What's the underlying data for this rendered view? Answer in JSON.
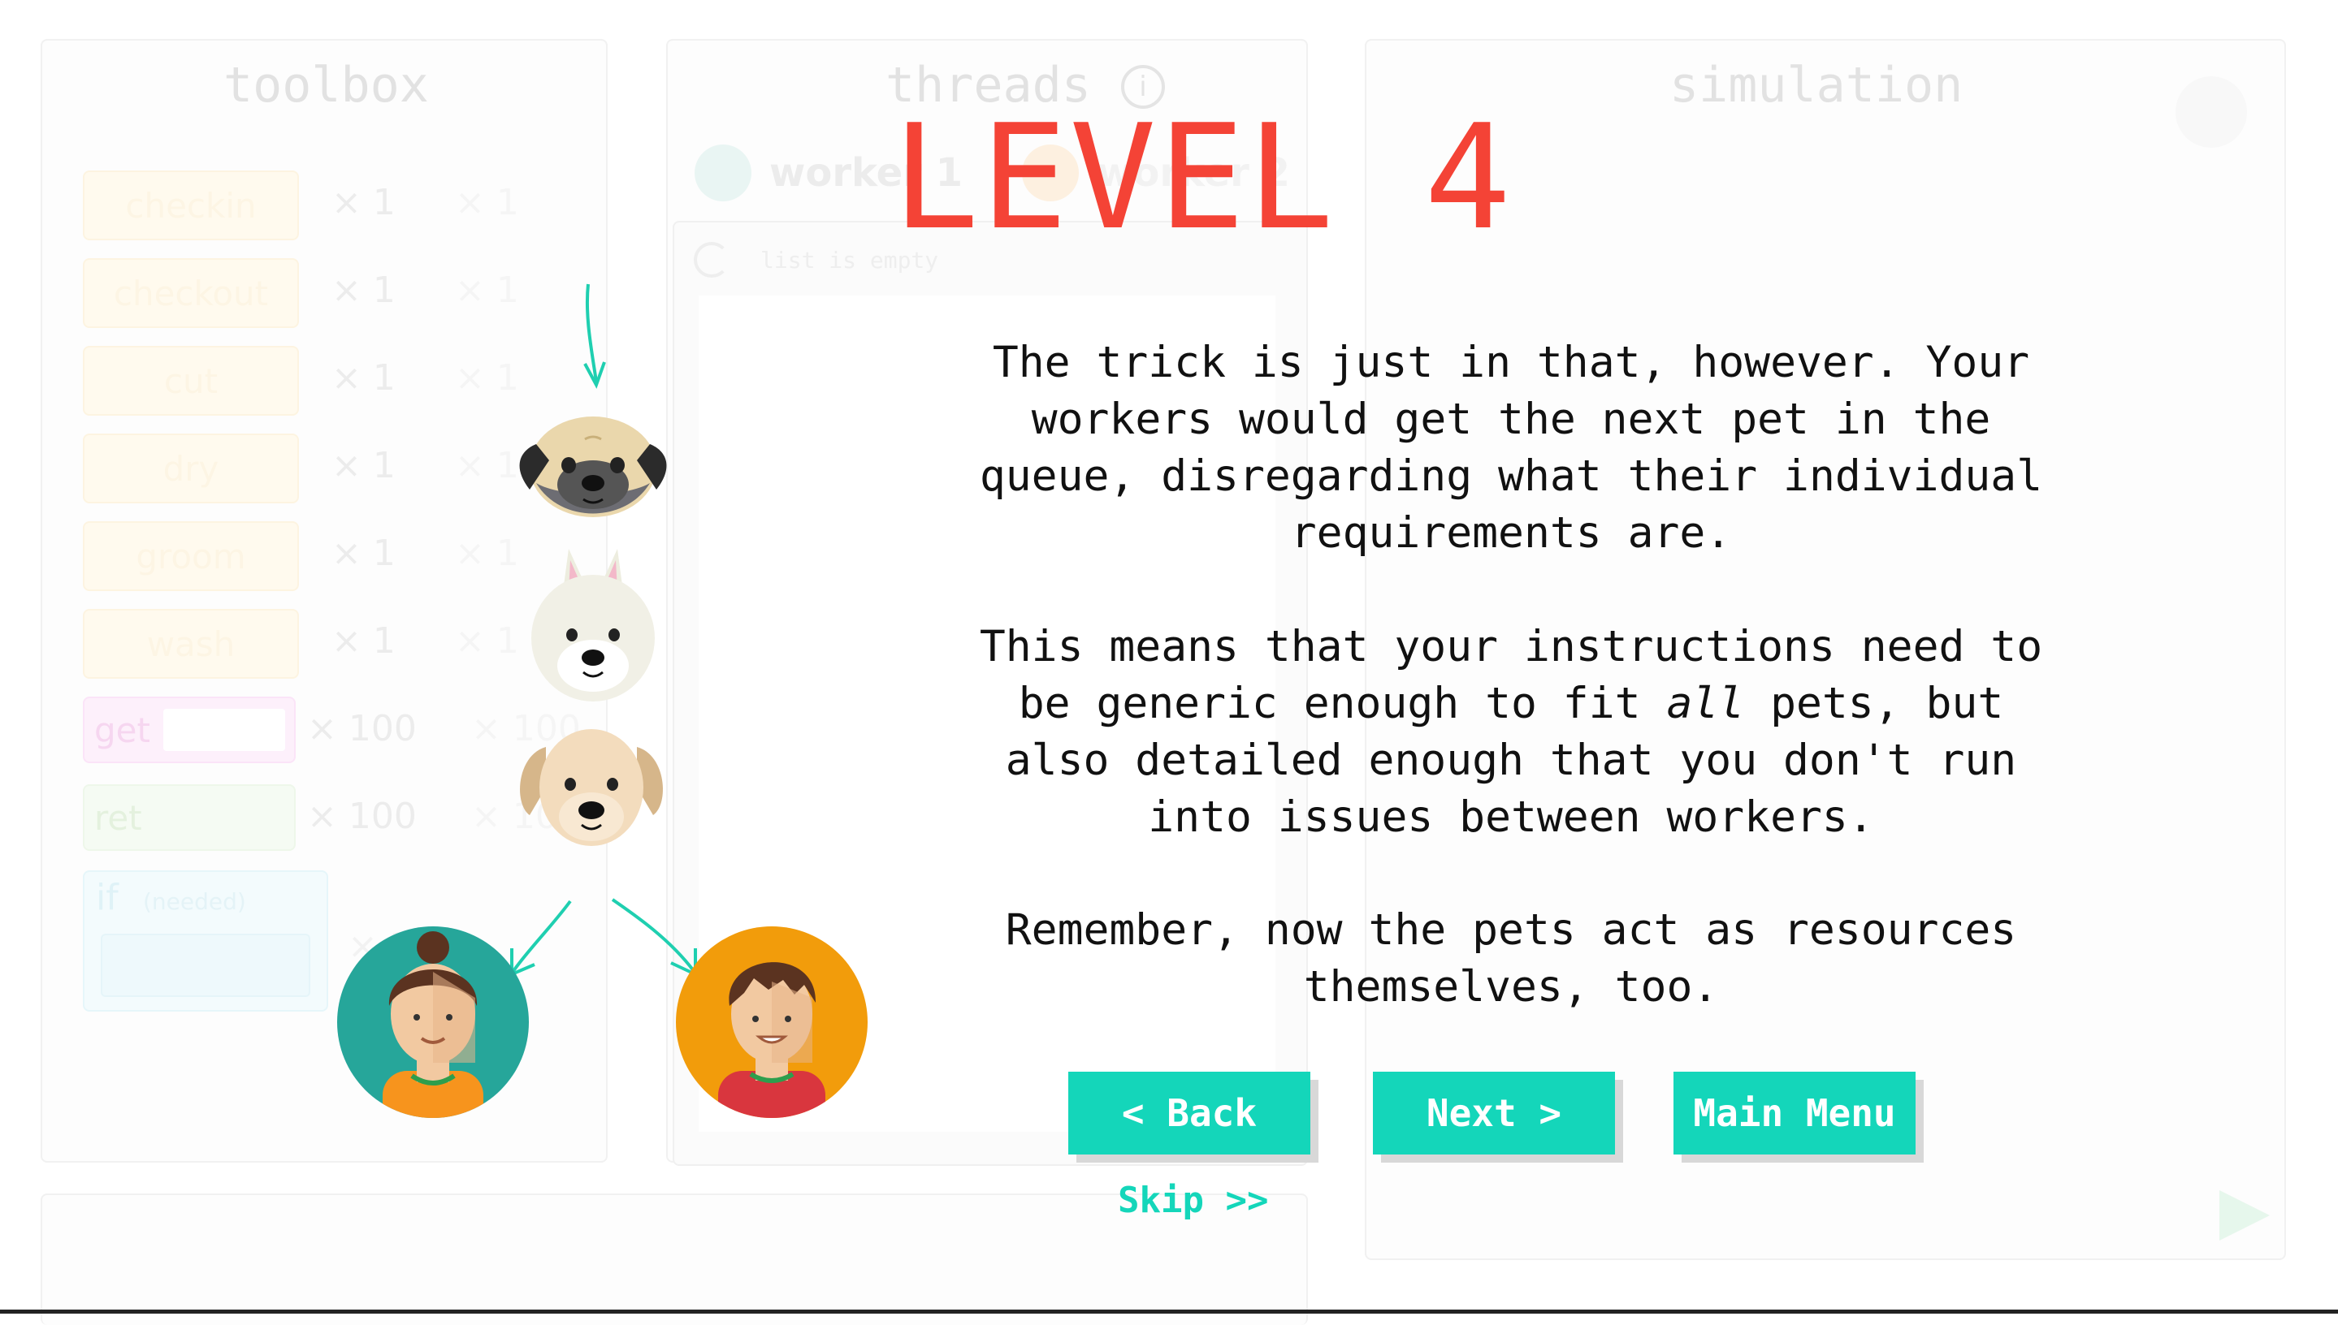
{
  "background": {
    "panels": {
      "toolbox_title": "toolbox",
      "threads_title": "threads",
      "simulation_title": "simulation"
    },
    "workers": [
      "worker 1",
      "worker 2"
    ],
    "queue_text": "list is empty",
    "tools": [
      {
        "label": "checkin",
        "count": "× 1",
        "count2": "× 1",
        "color": "yellow"
      },
      {
        "label": "checkout",
        "count": "× 1",
        "count2": "× 1",
        "color": "yellow"
      },
      {
        "label": "cut",
        "count": "× 1",
        "count2": "× 1",
        "color": "yellow"
      },
      {
        "label": "dry",
        "count": "× 1",
        "count2": "× 1",
        "color": "yellow"
      },
      {
        "label": "groom",
        "count": "× 1",
        "count2": "× 1",
        "color": "yellow"
      },
      {
        "label": "wash",
        "count": "× 1",
        "count2": "× 1",
        "color": "yellow"
      },
      {
        "label": "get",
        "count": "× 100",
        "count2": "× 100",
        "color": "pink"
      },
      {
        "label": "ret",
        "count": "× 100",
        "count2": "× 100",
        "color": "green"
      }
    ],
    "if_block": {
      "keyword": "if",
      "hint": "(needed)",
      "count": "× 1"
    }
  },
  "dialog": {
    "title": "LEVEL 4",
    "paragraph1": "The trick is just in that, however. Your workers would get the next pet in the queue, disregarding what their individual requirements are.",
    "paragraph2_a": "This means that your instructions need to be generic enough to fit ",
    "paragraph2_em": "all",
    "paragraph2_b": " pets, but also detailed enough that you don't run into issues between workers.",
    "paragraph3": "Remember, now the pets act as resources themselves, too.",
    "buttons": {
      "back": "< Back",
      "next": "Next >",
      "main_menu": "Main Menu"
    },
    "skip": "Skip >>"
  },
  "colors": {
    "accent": "#14d6ba",
    "title_red": "#f44336",
    "worker1_bg": "#26a69a",
    "worker2_bg": "#f29c0b"
  },
  "illustration": {
    "pets": [
      "pug-face",
      "white-dog-face",
      "labrador-face"
    ],
    "workers": [
      "woman-avatar",
      "man-avatar"
    ]
  }
}
